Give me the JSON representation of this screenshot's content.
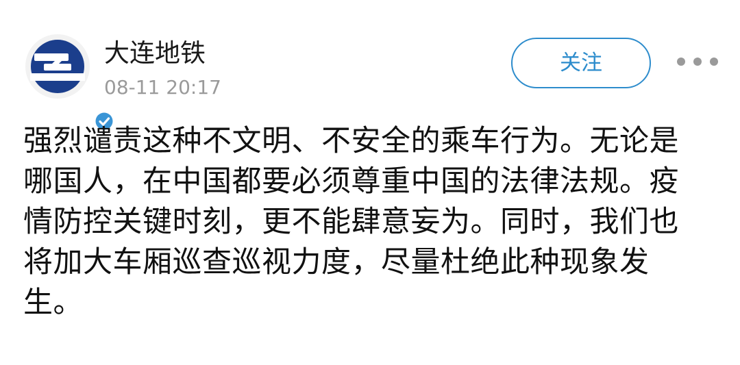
{
  "author": {
    "name": "大连地铁",
    "logo_icon": "dalian-metro-logo",
    "verified_icon": "verified-badge-icon",
    "brand_color": "#1b3e8c"
  },
  "post": {
    "timestamp": "08-11 20:17",
    "text": "强烈谴责这种不文明、不安全的乘车行为。无论是哪国人，在中国都要必须尊重中国的法律法规。疫情防控关键时刻，更不能肆意妄为。同时，我们也将加大车厢巡查巡视力度，尽量杜绝此种现象发生。"
  },
  "actions": {
    "follow_label": "关注",
    "more_icon": "more-dots-icon",
    "accent_color": "#2d8ccc"
  }
}
